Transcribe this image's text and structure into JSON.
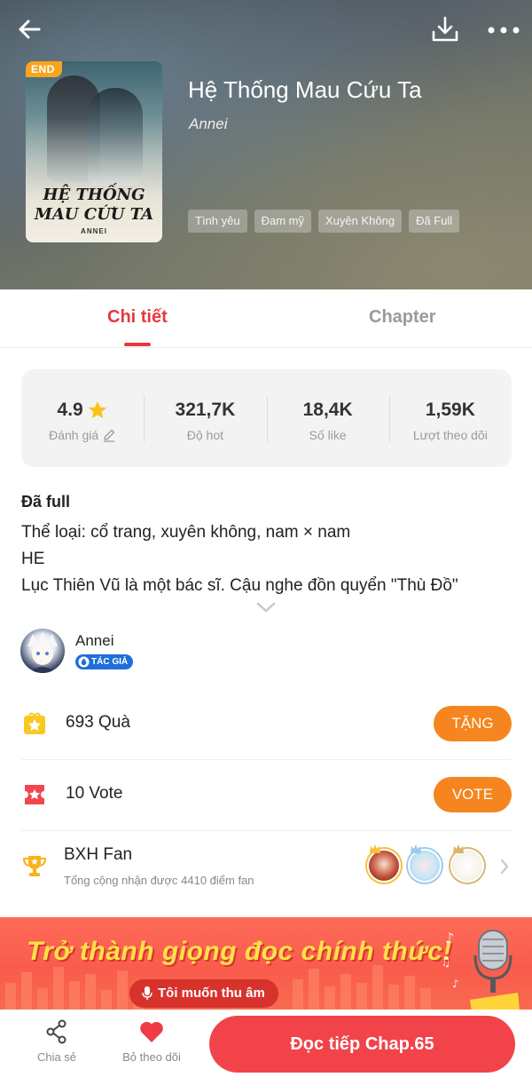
{
  "header": {
    "back_icon": "arrow-left-icon",
    "download_icon": "download-icon",
    "more_icon": "more-horizontal-icon",
    "cover": {
      "badge": "END",
      "title_line1": "HỆ THỐNG",
      "title_line2": "MAU CỨU TA",
      "author": "ANNEI"
    },
    "title": "Hệ Thống Mau Cứu Ta",
    "author": "Annei",
    "tags": [
      "Tình yêu",
      "Đam mỹ",
      "Xuyên Không",
      "Đã Full"
    ]
  },
  "tabs": [
    {
      "label": "Chi tiết",
      "active": true
    },
    {
      "label": "Chapter",
      "active": false
    }
  ],
  "stats": [
    {
      "value": "4.9",
      "label": "Đánh giá",
      "icon": "star-icon"
    },
    {
      "value": "321,7K",
      "label": "Độ hot"
    },
    {
      "value": "18,4K",
      "label": "Số like"
    },
    {
      "value": "1,59K",
      "label": "Lượt theo dõi"
    }
  ],
  "description": {
    "status": "Đã full",
    "lines": [
      "Thể loại: cổ trang, xuyên không, nam × nam",
      "HE",
      "Lục Thiên Vũ là một bác sĩ. Cậu nghe đồn quyển \"Thù Đồ\""
    ]
  },
  "author": {
    "name": "Annei",
    "badge": "TÁC GIẢ"
  },
  "gifts": {
    "text": "693 Quà",
    "button": "TẶNG"
  },
  "votes": {
    "text": "10 Vote",
    "button": "VOTE"
  },
  "fan_ranking": {
    "title": "BXH Fan",
    "subtitle": "Tổng cộng nhận được 4410 điểm fan"
  },
  "banner": {
    "title": "Trở thành giọng đọc chính thức!",
    "button": "Tôi muốn thu âm"
  },
  "bottom_bar": {
    "share": "Chia sẻ",
    "unfollow": "Bỏ theo dõi",
    "read": "Đọc tiếp Chap.65"
  },
  "colors": {
    "accent": "#e8383d",
    "orange": "#f6851f",
    "read_button": "#f2434a"
  }
}
